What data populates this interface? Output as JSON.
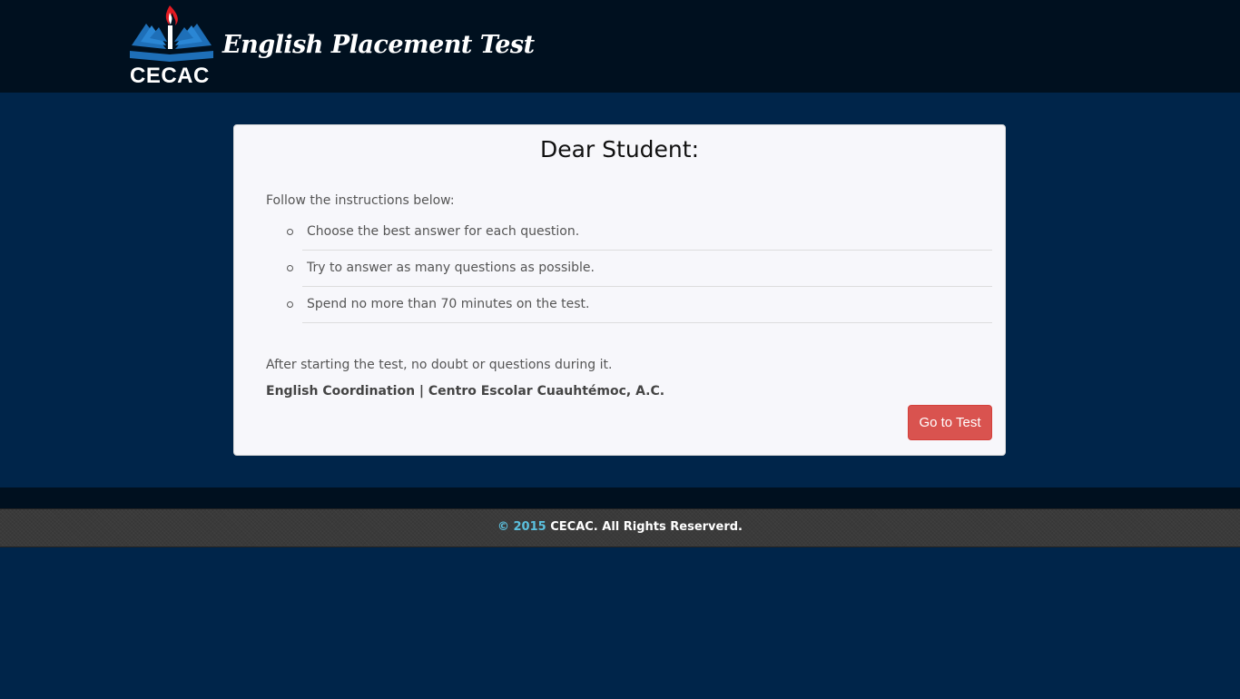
{
  "header": {
    "logo_text": "CECAC",
    "title": "English Placement Test"
  },
  "card": {
    "heading": "Dear Student:",
    "intro": "Follow the instructions below:",
    "instructions": [
      "Choose the best answer for each question.",
      "Try to answer as many questions as possible.",
      "Spend no more than 70 minutes on the test."
    ],
    "note": "After starting the test, no doubt or questions during it.",
    "signature": "English Coordination | Centro Escolar Cuauhtémoc, A.C.",
    "button_label": "Go to Test"
  },
  "footer": {
    "copyright_prefix": "© 2015",
    "copyright_rest": " CECAC. All Rights Reserverd."
  },
  "colors": {
    "header_bg": "#00101f",
    "page_bg": "#00254a",
    "card_bg": "#f7f7fb",
    "button_bg": "#d9534f",
    "footer_accent": "#5bc0de",
    "logo_blue": "#1e6fb8",
    "flame_red": "#e31b23"
  },
  "icons": {
    "logo": "book-flame-logo-icon"
  }
}
